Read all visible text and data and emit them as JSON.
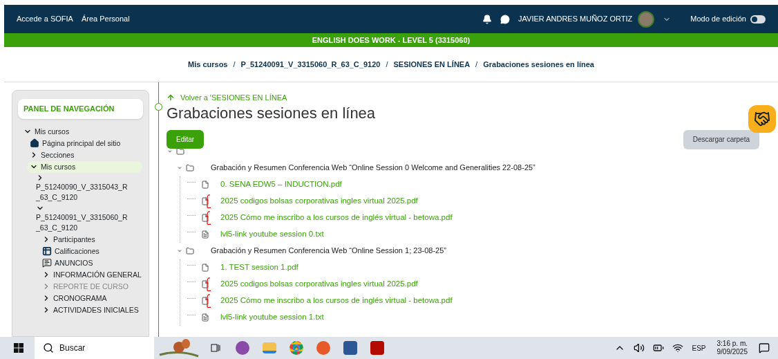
{
  "header": {
    "links": [
      "Accede a SOFIA",
      "Área Personal"
    ],
    "user_name": "JAVIER ANDRES MUÑOZ ORTIZ",
    "edit_mode": {
      "label": "Modo de edición",
      "on": false
    }
  },
  "course_bar": {
    "title": "ENGLISH DOES WORK - LEVEL 5 (3315060)"
  },
  "breadcrumb_separator": "/",
  "breadcrumb": [
    "Mis cursos",
    "P_51240091_V_3315060_R_63_C_9120",
    "SESIONES EN LÍNEA",
    "Grabaciones sesiones en línea"
  ],
  "sidebar": {
    "title": "PANEL DE NAVEGACIÓN",
    "tree": [
      {
        "label": "Mis cursos",
        "kind": "toggle",
        "expanded": true,
        "selected": false,
        "disabled": false,
        "children": [
          {
            "label": "Página principal del sitio",
            "kind": "home",
            "selected": false,
            "disabled": false
          },
          {
            "label": "Secciones",
            "kind": "toggle",
            "expanded": false,
            "selected": false,
            "disabled": false
          },
          {
            "label": "Mis cursos",
            "kind": "toggle",
            "expanded": true,
            "selected": true,
            "disabled": false,
            "children": [
              {
                "label": "P_51240090_V_3315043_R_63_C_9120",
                "kind": "course",
                "expanded": false,
                "selected": false,
                "disabled": false
              },
              {
                "label": "P_51240091_V_3315060_R_63_C_9120",
                "kind": "course",
                "expanded": true,
                "selected": false,
                "disabled": false,
                "children": [
                  {
                    "label": "Participantes",
                    "kind": "toggle",
                    "expanded": false,
                    "selected": false,
                    "disabled": false
                  },
                  {
                    "label": "Calificaciones",
                    "kind": "grades",
                    "selected": false,
                    "disabled": false
                  },
                  {
                    "label": "ANUNCIOS",
                    "kind": "forum",
                    "selected": false,
                    "disabled": false
                  },
                  {
                    "label": "INFORMACIÓN GENERAL",
                    "kind": "toggle",
                    "expanded": false,
                    "selected": false,
                    "disabled": false
                  },
                  {
                    "label": "REPORTE DE CURSO",
                    "kind": "toggle",
                    "expanded": false,
                    "selected": false,
                    "disabled": true
                  },
                  {
                    "label": "CRONOGRAMA",
                    "kind": "toggle",
                    "expanded": false,
                    "selected": false,
                    "disabled": false
                  },
                  {
                    "label": "ACTIVIDADES INICIALES",
                    "kind": "toggle",
                    "expanded": false,
                    "selected": false,
                    "disabled": false
                  }
                ]
              }
            ]
          }
        ]
      }
    ]
  },
  "main": {
    "back_link": "Volver a 'SESIONES EN LÍNEA",
    "title": "Grabaciones sesiones en línea",
    "edit_button": "Editar",
    "download_button": "Descargar carpeta",
    "folder": {
      "expanded": true,
      "children": [
        {
          "name": "Grabación y Resumen Conferencia Web “Online Session 0 Welcome and Generalities 22-08-25”",
          "expanded": true,
          "files": [
            {
              "name": "0. SENA EDW5 – INDUCTION.pdf",
              "kind": "pdf",
              "marked": false
            },
            {
              "name": "2025 codigos bolsas corporativas ingles virtual 2025.pdf",
              "kind": "pdf",
              "marked": true
            },
            {
              "name": "2025 Cómo me inscribo a los cursos de inglés virtual - betowa.pdf",
              "kind": "pdf",
              "marked": true
            },
            {
              "name": "lvl5-link youtube session 0.txt",
              "kind": "txt",
              "marked": false
            }
          ]
        },
        {
          "name": "Grabación y Resumen Conferencia Web “Online Session 1; 23-08-25”",
          "expanded": true,
          "files": [
            {
              "name": "1. TEST session 1.pdf",
              "kind": "pdf",
              "marked": false
            },
            {
              "name": "2025 codigos bolsas corporativas ingles virtual 2025.pdf",
              "kind": "pdf",
              "marked": true
            },
            {
              "name": "2025 Cómo me inscribo a los cursos de inglés virtual - betowa.pdf",
              "kind": "pdf",
              "marked": true
            },
            {
              "name": "lvl5-link youtube session 1.txt",
              "kind": "txt",
              "marked": false
            }
          ]
        }
      ]
    }
  },
  "taskbar": {
    "search_placeholder": "Buscar",
    "language": "ESP",
    "time": "3:16 p. m.",
    "date": "9/09/2025"
  }
}
